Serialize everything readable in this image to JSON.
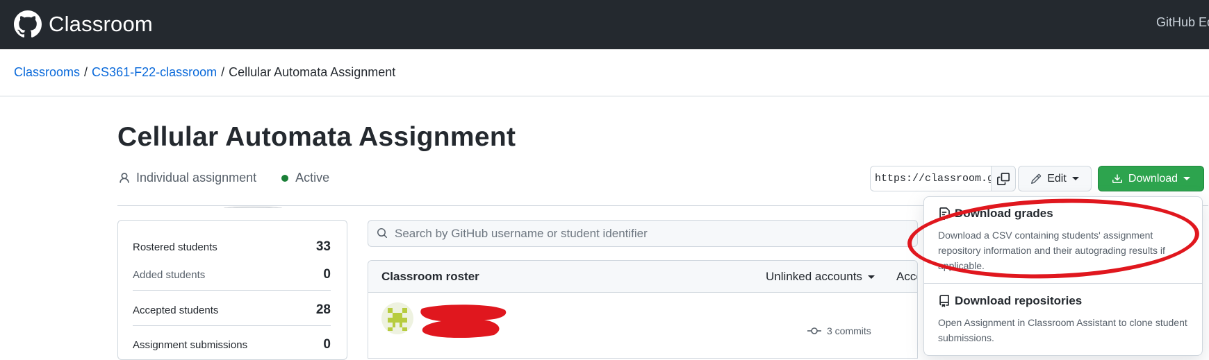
{
  "header": {
    "brand": "Classroom",
    "right_link": "GitHub Ed"
  },
  "breadcrumb": {
    "items": [
      "Classrooms",
      "CS361-F22-classroom"
    ],
    "separator": "/",
    "current": "Cellular Automata Assignment"
  },
  "assignment": {
    "title": "Cellular Automata Assignment",
    "type": "Individual assignment",
    "status": "Active",
    "status_color": "#1a7f37"
  },
  "actions": {
    "invite_link": "https://classroom.gi",
    "copy_icon": "copy-icon",
    "edit_label": "Edit",
    "download_label": "Download"
  },
  "download_menu": {
    "items": [
      {
        "title": "Download grades",
        "icon": "file-check-icon",
        "description": "Download a CSV containing students' assignment repository information and their autograding results if applicable."
      },
      {
        "title": "Download repositories",
        "icon": "repo-icon",
        "description": "Open Assignment in Classroom Assistant to clone student submissions."
      }
    ]
  },
  "stats": {
    "rows": [
      {
        "label": "Rostered students",
        "value": "33"
      },
      {
        "label": "Added students",
        "value": "0"
      },
      {
        "label": "Accepted students",
        "value": "28"
      },
      {
        "label": "Assignment submissions",
        "value": "0"
      }
    ]
  },
  "search": {
    "placeholder": "Search by GitHub username or student identifier"
  },
  "roster": {
    "title": "Classroom roster",
    "filter_label": "Unlinked accounts",
    "accepted_label": "Accep",
    "rows": [
      {
        "commits": "3 commits"
      }
    ]
  },
  "colors": {
    "header_bg": "#24292f",
    "link": "#0969da",
    "primary_button": "#2da44e",
    "annotation": "#e0171e"
  }
}
